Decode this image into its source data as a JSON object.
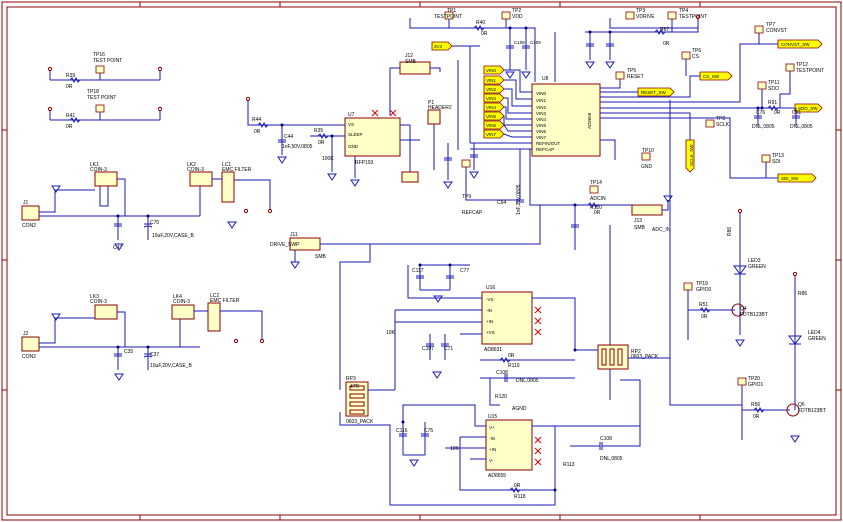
{
  "connectors": {
    "j1": "J1",
    "j1_name": "CON2",
    "j2": "J2",
    "j2_name": "CON2",
    "j11": "J11",
    "j11_name": "SMB",
    "j11_net": "DRIVE_SWP",
    "j12": "J12",
    "j12_name": "SMB",
    "j13": "J13",
    "j13_name": "SMB",
    "j13_net": "ADC_IN",
    "p1": "P1",
    "p1_name": "HEADER2"
  },
  "ics": {
    "u7": "U7",
    "u7_part": "RFP193",
    "u7_pins": [
      "VS",
      "SLEEP",
      "GND"
    ],
    "u8": "U8",
    "u8_part": "AD8658",
    "u8_left": [
      "VIN0",
      "VIN1",
      "VIN2",
      "VIN3",
      "VIN4",
      "VIN5",
      "VIN6",
      "VIN7",
      "REFIN/OUT",
      "REFCAP"
    ],
    "u16": "U16",
    "u16_part": "AD8631",
    "u16_pins": [
      "-VS",
      "-IN",
      "+IN",
      "+VS"
    ],
    "u15": "U15",
    "u15_part": "AD8655",
    "u15_pins": [
      "V+",
      "-IN",
      "+IN",
      "V-"
    ]
  },
  "regulators": {
    "lk1": "LK1",
    "lk1_type": "COIN-3",
    "lk2": "LK2",
    "lk2_type": "COIN-3",
    "lk3": "LK3",
    "lk3_type": "COIN-3",
    "lk4": "LK4",
    "lk4_type": "COIN-3",
    "lc1": "LC1",
    "lc1_type": "EMC FILTER",
    "lc2": "LC2",
    "lc2_type": "EMC FILTER"
  },
  "testpoints": {
    "tp1": "TP1",
    "tp1_name": "TESTPOINT",
    "tp2": "TP2",
    "tp2_name": "VDD",
    "tp3": "TP3",
    "tp3_name": "VDRIVE",
    "tp4": "TP4",
    "tp4_name": "TESTPOINT",
    "tp5": "TP5",
    "tp5_name": "RESET",
    "tp6": "TP6",
    "tp6_name": "CS",
    "tp7": "TP7",
    "tp7_name": "CONVST",
    "tp8": "TP8",
    "tp8_name": "SCLK",
    "tp9": "TP9",
    "tp9_name": "REFCAP",
    "tp10": "TP10",
    "tp10_name": "GND",
    "tp11": "TP11",
    "tp11_name": "SDO",
    "tp12": "TP12",
    "tp12_name": "TESTPOINT",
    "tp13": "TP13",
    "tp13_name": "SDI",
    "tp14": "TP14",
    "tp14_name": "ADCIN",
    "tp16": "TP16",
    "tp16_name": "TEST POINT",
    "tp18": "TP18",
    "tp18_name": "TEST POINT",
    "tp19": "TP19",
    "tp19_name": "GPIO0",
    "tp20": "TP20",
    "tp20_name": "GPIO1"
  },
  "nets": {
    "vin": [
      "VIN0",
      "VIN1",
      "VIN2",
      "VIN3",
      "VIN4",
      "VIN5",
      "VIN6",
      "VIN7"
    ],
    "convst": "CONVST_SW",
    "cs": "CS_SW",
    "reset": "RESET_SW",
    "sdo": "SDO_SW",
    "sclk": "SCLK_SW",
    "sdi": "SDI_SW",
    "v3": "3V3",
    "adc_in": "ADC_IN"
  },
  "passives": {
    "r39": "R39",
    "r41": "R41",
    "r44": "R44",
    "r35": "R35",
    "r40": "R40",
    "r67": "R67",
    "r91": "R91",
    "r90": "R90",
    "r51": "R51",
    "r56": "R56",
    "r86": "R86",
    "r113": "R113",
    "r118": "R118",
    "r119": "R119",
    "r120": "R120",
    "zero": "0R",
    "r10k": "10K",
    "r100k": "100K",
    "c44": "C44",
    "c44_val": "1nF,50V,0805",
    "c47": "C47",
    "c70": "C70",
    "c70_val": "10uF,20V,CASE_B",
    "c35": "C35",
    "c37": "C37",
    "c37_val": "10uF,20V,CASE_B",
    "c64": "C64",
    "c64_val": "1nF,25V,0805",
    "c76": "C76",
    "c91": "C91",
    "dnl": "DNL,0805",
    "c117": "C117",
    "c77": "C77",
    "c107": "C107",
    "c71": "C71",
    "c116": "C116",
    "c75": "C75",
    "c108": "C108",
    "c109": "C109",
    "cap_val": "0.1uF,50V,0805"
  },
  "packs": {
    "rp1": "RP1",
    "rp2": "RP2",
    "rp3": "RP3",
    "pack": "0603_PACK",
    "rp1_vals": [
      "47R",
      "47R",
      "47R",
      "47R"
    ]
  },
  "leds": {
    "led3": "LED3",
    "led3_color": "GREEN",
    "led4": "LED4",
    "led4_color": "GREEN",
    "q4": "Q4",
    "q4_part": "FDTB123BT",
    "q6": "Q6",
    "q6_part": "FDTB123BT"
  }
}
